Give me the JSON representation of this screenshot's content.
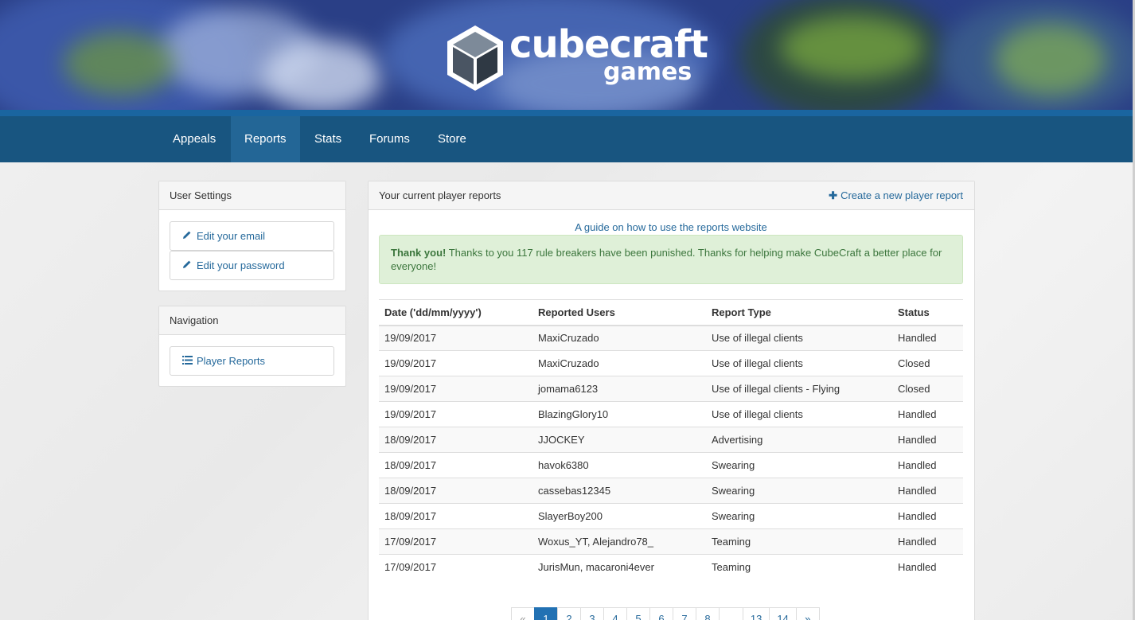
{
  "brand": {
    "line1": "cubecraft",
    "line2": "games"
  },
  "nav": {
    "items": [
      {
        "label": "Appeals"
      },
      {
        "label": "Reports"
      },
      {
        "label": "Stats"
      },
      {
        "label": "Forums"
      },
      {
        "label": "Store"
      }
    ],
    "active": "Reports"
  },
  "sidebar": {
    "settings": {
      "title": "User Settings",
      "edit_email": "Edit your email",
      "edit_password": "Edit your password"
    },
    "navigation": {
      "title": "Navigation",
      "player_reports": "Player Reports"
    }
  },
  "main": {
    "title": "Your current player reports",
    "create_label": "Create a new player report",
    "guide_link": "A guide on how to use the reports website",
    "alert": {
      "strong": "Thank you!",
      "text": "Thanks to you 117 rule breakers have been punished. Thanks for helping make CubeCraft a better place for everyone!"
    },
    "table": {
      "headers": [
        "Date ('dd/mm/yyyy')",
        "Reported Users",
        "Report Type",
        "Status"
      ],
      "rows": [
        {
          "date": "19/09/2017",
          "users": "MaxiCruzado",
          "type": "Use of illegal clients",
          "status": "Handled"
        },
        {
          "date": "19/09/2017",
          "users": "MaxiCruzado",
          "type": "Use of illegal clients",
          "status": "Closed"
        },
        {
          "date": "19/09/2017",
          "users": "jomama6123",
          "type": "Use of illegal clients - Flying",
          "status": "Closed"
        },
        {
          "date": "19/09/2017",
          "users": "BlazingGlory10",
          "type": "Use of illegal clients",
          "status": "Handled"
        },
        {
          "date": "18/09/2017",
          "users": "JJOCKEY",
          "type": "Advertising",
          "status": "Handled"
        },
        {
          "date": "18/09/2017",
          "users": "havok6380",
          "type": "Swearing",
          "status": "Handled"
        },
        {
          "date": "18/09/2017",
          "users": "cassebas12345",
          "type": "Swearing",
          "status": "Handled"
        },
        {
          "date": "18/09/2017",
          "users": "SlayerBoy200",
          "type": "Swearing",
          "status": "Handled"
        },
        {
          "date": "17/09/2017",
          "users": "Woxus_YT, Alejandro78_",
          "type": "Teaming",
          "status": "Handled"
        },
        {
          "date": "17/09/2017",
          "users": "JurisMun, macaroni4ever",
          "type": "Teaming",
          "status": "Handled"
        }
      ]
    },
    "pagination": [
      "«",
      "1",
      "2",
      "3",
      "4",
      "5",
      "6",
      "7",
      "8",
      "...",
      "13",
      "14",
      "»"
    ],
    "current_page": "1"
  },
  "colors": {
    "nav_bg": "#185580",
    "link": "#25699b",
    "handled": "#3a9d3a",
    "closed": "#c9302c",
    "alert_bg": "#dff0d8"
  }
}
